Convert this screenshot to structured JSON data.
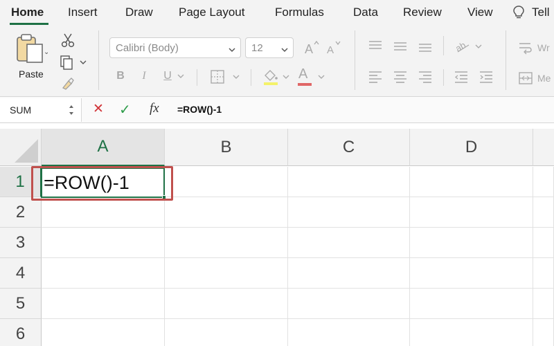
{
  "tabs": [
    "Home",
    "Insert",
    "Draw",
    "Page Layout",
    "Formulas",
    "Data",
    "Review",
    "View",
    "Tell"
  ],
  "ribbon": {
    "paste_label": "Paste",
    "font_name": "Calibri (Body)",
    "font_size": "12",
    "bold": "B",
    "italic": "I",
    "underline": "U",
    "font_color_letter": "A",
    "wrap_text_partial": "Wr",
    "merge_partial": "Me"
  },
  "formula_bar": {
    "name_box": "SUM",
    "cancel": "✕",
    "enter": "✓",
    "fx": "fx",
    "formula": "=ROW()-1"
  },
  "grid": {
    "columns": [
      "A",
      "B",
      "C",
      "D"
    ],
    "rows": [
      "1",
      "2",
      "3",
      "4",
      "5",
      "6"
    ],
    "active_cell_text": "=ROW()-1"
  },
  "colors": {
    "accent_green": "#1e7145",
    "highlight_red": "#c0504d",
    "cancel_red": "#d13438",
    "enter_green": "#2e9c4a"
  }
}
